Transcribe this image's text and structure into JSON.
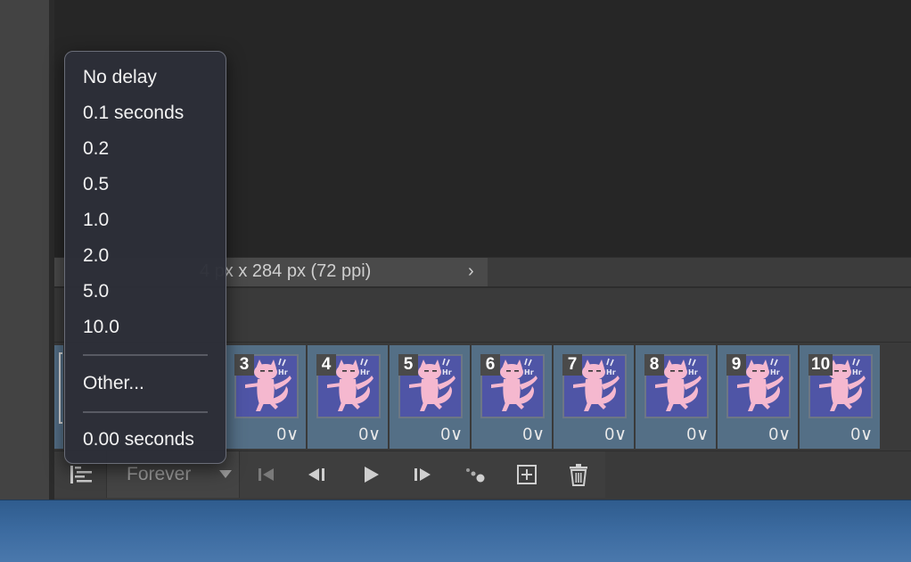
{
  "status": {
    "info": "4 px x 284 px (72 ppi)",
    "arrow": "›"
  },
  "frames": [
    {
      "number": "3",
      "delay": "0∨"
    },
    {
      "number": "4",
      "delay": "0∨"
    },
    {
      "number": "5",
      "delay": "0∨"
    },
    {
      "number": "6",
      "delay": "0∨"
    },
    {
      "number": "7",
      "delay": "0∨"
    },
    {
      "number": "8",
      "delay": "0∨"
    },
    {
      "number": "9",
      "delay": "0∨"
    },
    {
      "number": "10",
      "delay": "0∨"
    }
  ],
  "toolbar": {
    "loop_value": "Forever"
  },
  "delay_menu": {
    "items": [
      "No delay",
      "0.1 seconds",
      "0.2",
      "0.5",
      "1.0",
      "2.0",
      "5.0",
      "10.0"
    ],
    "other": "Other...",
    "current": "0.00 seconds"
  },
  "colors": {
    "frame_bg": "#546f86",
    "thumb_bg": "#4f55a6",
    "cat": "#f5b8cf"
  },
  "icons": [
    "timeline-convert-icon",
    "first-frame-icon",
    "previous-frame-icon",
    "play-icon",
    "next-frame-icon",
    "tween-icon",
    "duplicate-frame-icon",
    "trash-icon"
  ]
}
